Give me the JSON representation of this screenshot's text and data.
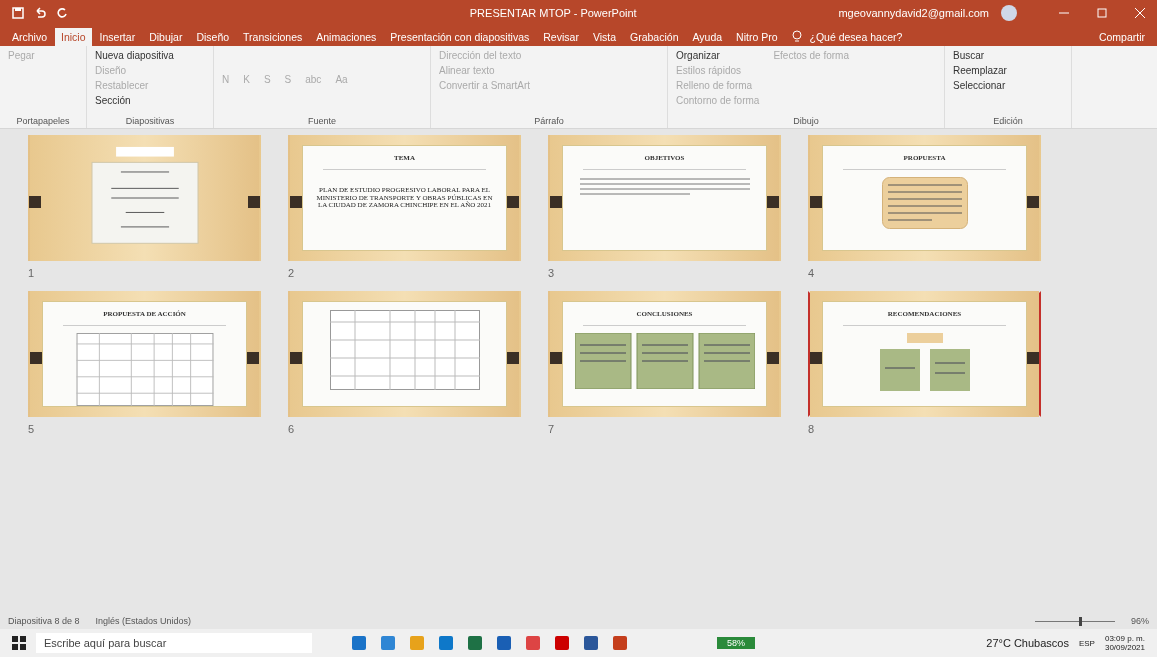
{
  "window": {
    "title": "PRESENTAR MTOP  -  PowerPoint",
    "account": "mgeovannydavid2@gmail.com"
  },
  "tabs": [
    {
      "label": "Archivo",
      "selected": false
    },
    {
      "label": "Inicio",
      "selected": true
    },
    {
      "label": "Insertar",
      "selected": false
    },
    {
      "label": "Dibujar",
      "selected": false
    },
    {
      "label": "Diseño",
      "selected": false
    },
    {
      "label": "Transiciones",
      "selected": false
    },
    {
      "label": "Animaciones",
      "selected": false
    },
    {
      "label": "Presentación con diapositivas",
      "selected": false
    },
    {
      "label": "Revisar",
      "selected": false
    },
    {
      "label": "Vista",
      "selected": false
    },
    {
      "label": "Grabación",
      "selected": false
    },
    {
      "label": "Ayuda",
      "selected": false
    },
    {
      "label": "Nitro Pro",
      "selected": false
    }
  ],
  "tell_me": "¿Qué desea hacer?",
  "share": "Compartir",
  "ribbon": [
    {
      "label": "Portapapeles",
      "items": [
        {
          "label": "Pegar",
          "disabled": true
        }
      ]
    },
    {
      "label": "Diapositivas",
      "items": [
        {
          "label": "Nueva diapositiva",
          "disabled": false
        },
        {
          "label": "Diseño",
          "disabled": true
        },
        {
          "label": "Restablecer",
          "disabled": true
        },
        {
          "label": "Sección",
          "disabled": false
        }
      ]
    },
    {
      "label": "Fuente",
      "items": [
        {
          "label": "N",
          "disabled": true
        },
        {
          "label": "K",
          "disabled": true
        },
        {
          "label": "S",
          "disabled": true
        },
        {
          "label": "S",
          "disabled": true
        },
        {
          "label": "abc",
          "disabled": true
        },
        {
          "label": "Aa",
          "disabled": true
        }
      ]
    },
    {
      "label": "Párrafo",
      "items": [
        {
          "label": "Dirección del texto",
          "disabled": true
        },
        {
          "label": "Alinear texto",
          "disabled": true
        },
        {
          "label": "Convertir a SmartArt",
          "disabled": true
        }
      ]
    },
    {
      "label": "Dibujo",
      "items": [
        {
          "label": "Organizar",
          "disabled": false
        },
        {
          "label": "Estilos rápidos",
          "disabled": true
        },
        {
          "label": "Relleno de forma",
          "disabled": true
        },
        {
          "label": "Contorno de forma",
          "disabled": true
        },
        {
          "label": "Efectos de forma",
          "disabled": true
        }
      ]
    },
    {
      "label": "Edición",
      "items": [
        {
          "label": "Buscar",
          "disabled": false
        },
        {
          "label": "Reemplazar",
          "disabled": false
        },
        {
          "label": "Seleccionar",
          "disabled": false
        }
      ]
    }
  ],
  "slides": [
    {
      "number": "1",
      "kind": "cover",
      "selected": false
    },
    {
      "number": "2",
      "kind": "topic",
      "selected": false,
      "title": "TEMA",
      "body": "PLAN DE ESTUDIO PROGRESIVO LABORAL PARA EL MINISTERIO DE TRANSPORTE Y OBRAS PÚBLICAS EN LA CIUDAD DE ZAMORA CHINCHIPE EN EL AÑO 2021"
    },
    {
      "number": "3",
      "kind": "text",
      "selected": false,
      "title": "OBJETIVOS"
    },
    {
      "number": "4",
      "kind": "box",
      "selected": false,
      "title": "PROPUESTA"
    },
    {
      "number": "5",
      "kind": "table",
      "selected": false,
      "title": "PROPUESTA DE ACCIÓN"
    },
    {
      "number": "6",
      "kind": "table",
      "selected": false
    },
    {
      "number": "7",
      "kind": "columns",
      "selected": false,
      "title": "CONCLUSIONES"
    },
    {
      "number": "8",
      "kind": "recommend",
      "selected": true,
      "title": "RECOMENDACIONES"
    }
  ],
  "status_bar": {
    "slide": "Diapositiva 8 de 8",
    "language": "Inglés (Estados Unidos)",
    "zoom": "96%",
    "level": 0.55
  },
  "taskbar": {
    "search": {
      "placeholder": "Escribe aquí para buscar"
    },
    "battery": "58%",
    "weather": "27°C  Chubascos",
    "lang": "ESP",
    "time": "03:09 p. m.",
    "date": "30/09/2021"
  }
}
